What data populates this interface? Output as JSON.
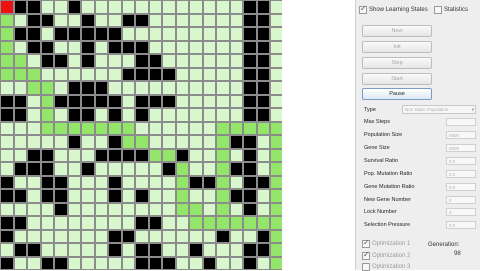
{
  "grid": {
    "rows": [
      "RBBWWBWWWWWWWWWWWWBBWW",
      "GWBBWWBWWBBWWWWWWWBBWB",
      "GBBWBBBBBWWWWWWWWWBBWB",
      "GWBBWWBWBBBWWWWWWWBBWB",
      "GGWBBWBWWWBBWWWWWWBBWW",
      "GGGWWWWWWBBBBWWWWWBBWB",
      "WWGGWBBBWWWWWWWWWWBBWB",
      "BBWGBBBBBWBBBWWWWWBBWB",
      "BBWGWBBWBWBWWWWWWWBBWW",
      "WWWGGGGGGGWWWWWWGGGGGB",
      "WWWWWBWWBGGWWWWWGBBWGB",
      "WWBBWWWBBBBGGBWWGWBWGB",
      "WBBBWWBWWWWWBGWWGBBWGB",
      "BWWBBWWWBWWWWGBBGWBBGB",
      "BBWBBWWWBWBWWGWWGBBWGB",
      "WWWWBWWWWWWWWGGWGWBWGB",
      "BBWWWWWWWWBBWWGGGGGGGB",
      "BWWWWWWWBBWWWWWWBWWBGB",
      "WBBWWWWWBWBBWWBWWWBBGB",
      "BWWBBWWWWWBBBWWBWWBWGU"
    ],
    "palette": {
      "W": "#d9f7cc",
      "G": "#93e66a",
      "B": "#000000",
      "R": "#ee1111",
      "U": "#1111ee"
    }
  },
  "panel": {
    "checkboxes": [
      {
        "label": "Show Learning States",
        "checked": true
      },
      {
        "label": "Statistics",
        "checked": false
      }
    ],
    "buttons": {
      "new": "New",
      "init": "Init",
      "step": "Step",
      "start": "Start",
      "pause": "Pause"
    },
    "type": {
      "label": "Type",
      "value": "Non Static Population"
    },
    "params": [
      {
        "label": "Max Steps",
        "value": ""
      },
      {
        "label": "Population Size",
        "value": "0000"
      },
      {
        "label": "Gene Size",
        "value": "0000"
      },
      {
        "label": "Survival Ratio",
        "value": "0.0"
      },
      {
        "label": "Pop. Mutation Ratio",
        "value": "0.0"
      },
      {
        "label": "Gene Mutation Ratio",
        "value": "0.0"
      },
      {
        "label": "New Gene Number",
        "value": "0"
      },
      {
        "label": "Lock Number",
        "value": "0"
      },
      {
        "label": "Selection Pressure",
        "value": "0.0"
      }
    ],
    "optimizations": [
      {
        "label": "Optimization 1",
        "checked": true
      },
      {
        "label": "Optimization 2",
        "checked": true
      },
      {
        "label": "Optimization 3",
        "checked": false
      }
    ],
    "generation": {
      "label": "Generation:",
      "value": "98"
    }
  }
}
